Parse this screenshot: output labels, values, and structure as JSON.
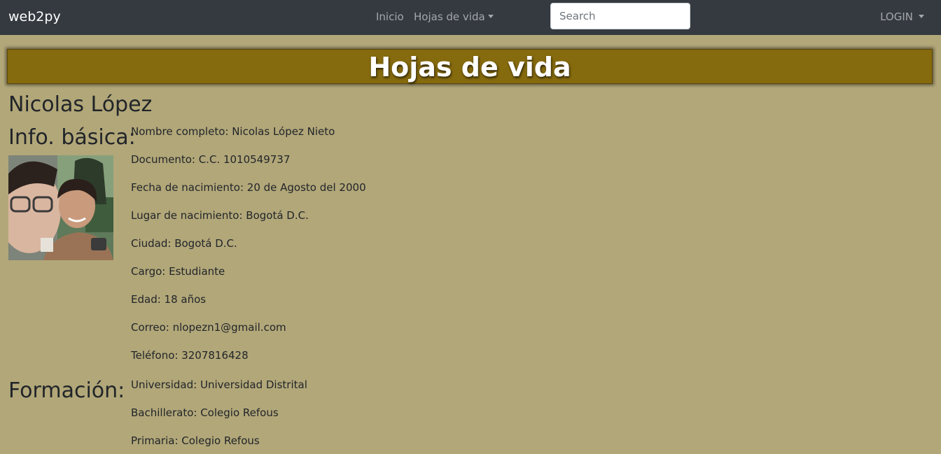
{
  "navbar": {
    "brand": "web2py",
    "links": [
      "Inicio",
      "Hojas de vida"
    ],
    "search_placeholder": "Search",
    "login": "LOGIN"
  },
  "banner": {
    "title": "Hojas de vida"
  },
  "person": {
    "name": "Nicolas López"
  },
  "basic_info": {
    "title": "Info. básica:",
    "photo_icon": "profile-photo-icon",
    "fields": [
      "Nombre completo: Nicolas López Nieto",
      "Documento: C.C. 1010549737",
      "Fecha de nacimiento: 20 de Agosto del 2000",
      "Lugar de nacimiento: Bogotá D.C.",
      "Ciudad: Bogotá D.C.",
      "Cargo: Estudiante",
      "Edad: 18 años",
      "Correo: nlopezn1@gmail.com",
      "Teléfono: 3207816428"
    ]
  },
  "formacion": {
    "title": "Formación:",
    "fields": [
      "Universidad: Universidad Distrital",
      "Bachillerato: Colegio Refous",
      "Primaria: Colegio Refous"
    ]
  },
  "colors": {
    "navbar": "#343a40",
    "page_bg": "#b2a779",
    "banner_bg": "#866a0e"
  }
}
